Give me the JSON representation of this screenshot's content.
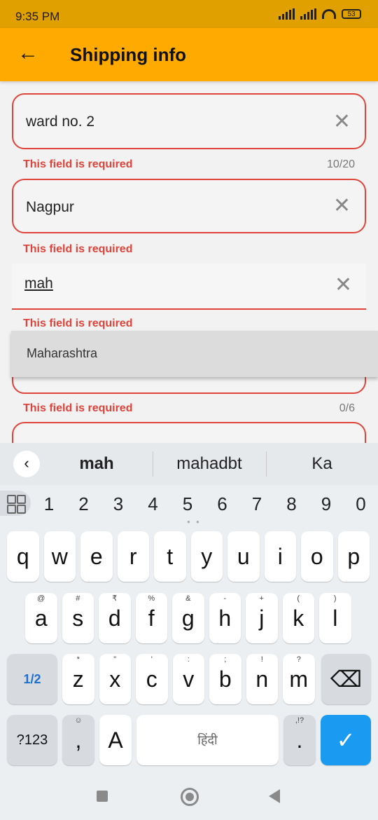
{
  "status_bar": {
    "time": "9:35 PM",
    "battery": "53"
  },
  "app_bar": {
    "title": "Shipping info"
  },
  "fields": {
    "address": {
      "value": "ward no. 2",
      "error": "This field is required",
      "counter": "10/20"
    },
    "city": {
      "value": "Nagpur",
      "error": "This field is required"
    },
    "state": {
      "value": "mah",
      "error": "This field is required"
    },
    "pincode": {
      "error": "This field is required",
      "counter": "0/6"
    }
  },
  "autocomplete": {
    "option": "Maharashtra"
  },
  "keyboard": {
    "suggestions": [
      "mah",
      "mahadbt",
      "Ka"
    ],
    "numbers": [
      "1",
      "2",
      "3",
      "4",
      "5",
      "6",
      "7",
      "8",
      "9",
      "0"
    ],
    "row1": [
      {
        "k": "q",
        "s": ""
      },
      {
        "k": "w",
        "s": ""
      },
      {
        "k": "e",
        "s": ""
      },
      {
        "k": "r",
        "s": ""
      },
      {
        "k": "t",
        "s": ""
      },
      {
        "k": "y",
        "s": ""
      },
      {
        "k": "u",
        "s": ""
      },
      {
        "k": "i",
        "s": ""
      },
      {
        "k": "o",
        "s": ""
      },
      {
        "k": "p",
        "s": ""
      }
    ],
    "row2": [
      {
        "k": "a",
        "s": "@"
      },
      {
        "k": "s",
        "s": "#"
      },
      {
        "k": "d",
        "s": "₹"
      },
      {
        "k": "f",
        "s": "%"
      },
      {
        "k": "g",
        "s": "&"
      },
      {
        "k": "h",
        "s": "-"
      },
      {
        "k": "j",
        "s": "+"
      },
      {
        "k": "k",
        "s": "("
      },
      {
        "k": "l",
        "s": ")"
      }
    ],
    "row3": [
      {
        "k": "z",
        "s": "*"
      },
      {
        "k": "x",
        "s": "\""
      },
      {
        "k": "c",
        "s": "'"
      },
      {
        "k": "v",
        "s": ":"
      },
      {
        "k": "b",
        "s": ";"
      },
      {
        "k": "n",
        "s": "!"
      },
      {
        "k": "m",
        "s": "?"
      }
    ],
    "shift_label": "1/2",
    "symbols_label": "?123",
    "comma": ",",
    "comma_sup": "☺",
    "lang_key": "A",
    "space_label": "हिंदी",
    "period": ".",
    "period_sup": ",!?"
  }
}
